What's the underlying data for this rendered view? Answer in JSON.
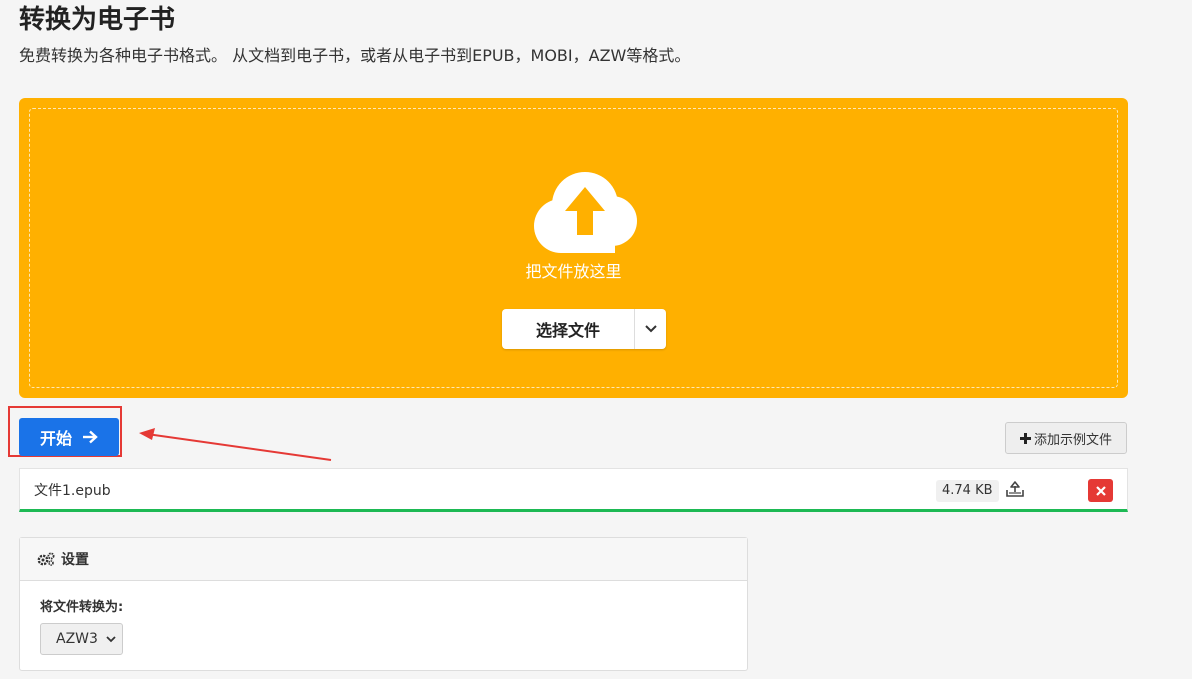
{
  "header": {
    "title": "转换为电子书",
    "subtitle": "免费转换为各种电子书格式。 从文档到电子书，或者从电子书到EPUB，MOBI，AZW等格式。"
  },
  "dropzone": {
    "drop_text": "把文件放这里",
    "choose_file_label": "选择文件",
    "background_color": "#ffb000"
  },
  "actions": {
    "start_label": "开始",
    "start_color": "#1a73e8",
    "add_example_label": "添加示例文件"
  },
  "file": {
    "name": "文件1.epub",
    "size": "4.74 KB",
    "progress": 1.0,
    "progress_color": "#1db954"
  },
  "settings": {
    "title": "设置",
    "convert_to_label": "将文件转换为:",
    "selected_format": "AZW3"
  },
  "icons": {
    "upload": "cloud-upload-icon",
    "start_arrow": "arrow-right-icon",
    "add": "plus-icon",
    "download": "download-tray-icon",
    "remove": "close-icon",
    "settings": "gears-icon",
    "dropdown": "chevron-down-icon"
  }
}
